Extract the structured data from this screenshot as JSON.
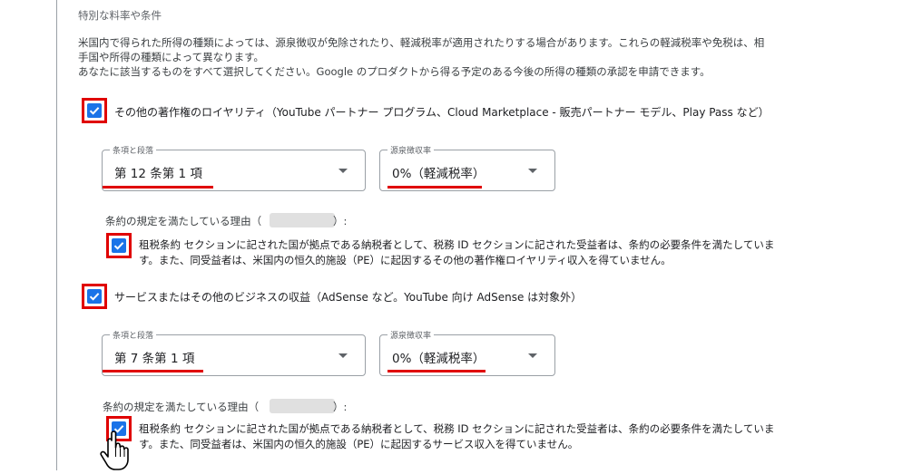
{
  "section": {
    "title": "特別な料率や条件",
    "desc_line1": "米国内で得られた所得の種類によっては、源泉徴収が免除されたり、軽減税率が適用されたりする場合があります。これらの軽減税率や免税は、相",
    "desc_line2": "手国や所得の種類によって異なります。",
    "desc_line3": "あなたに該当するものをすべて選択してください。Google のプロダクトから得る予定のある今後の所得の種類の承認を申請できます。"
  },
  "income1": {
    "checked": true,
    "label": "その他の著作権のロイヤリティ（YouTube パートナー プログラム、Cloud Marketplace - 販売パートナー モデル、Play Pass など）",
    "article_label": "条項と段落",
    "article_value": "第 12 条第 1 項",
    "rate_label": "源泉徴収率",
    "rate_value": "0%（軽減税率）",
    "reason_prefix": "条約の規定を満たしている理由（",
    "reason_suffix": "）:",
    "treaty_checked": true,
    "treaty_line1": "租税条約 セクションに記された国が拠点である納税者として、税務 ID セクションに記された受益者は、条約の必要条件を満たしていま",
    "treaty_line2": "す。また、同受益者は、米国内の恒久的施設（PE）に起因するその他の著作権ロイヤリティ収入を得ていません。"
  },
  "income2": {
    "checked": true,
    "label": "サービスまたはその他のビジネスの収益（AdSense など。YouTube 向け AdSense は対象外）",
    "article_label": "条項と段落",
    "article_value": "第 7 条第 1 項",
    "rate_label": "源泉徴収率",
    "rate_value": "0%（軽減税率）",
    "reason_prefix": "条約の規定を満たしている理由（",
    "reason_suffix": "）:",
    "treaty_checked": true,
    "treaty_line1": "租税条約 セクションに記された国が拠点である納税者として、税務 ID セクションに記された受益者は、条約の必要条件を満たしていま",
    "treaty_line2": "す。また、同受益者は、米国内の恒久的施設（PE）に起因するサービス収入を得ていません。"
  },
  "colors": {
    "checkbox": "#1a73e8",
    "highlight": "#e00000"
  },
  "icons": {
    "checkbox": "checkbox-checked-icon",
    "dropdown": "dropdown-arrow-icon",
    "cursor": "hand-pointer-icon"
  }
}
